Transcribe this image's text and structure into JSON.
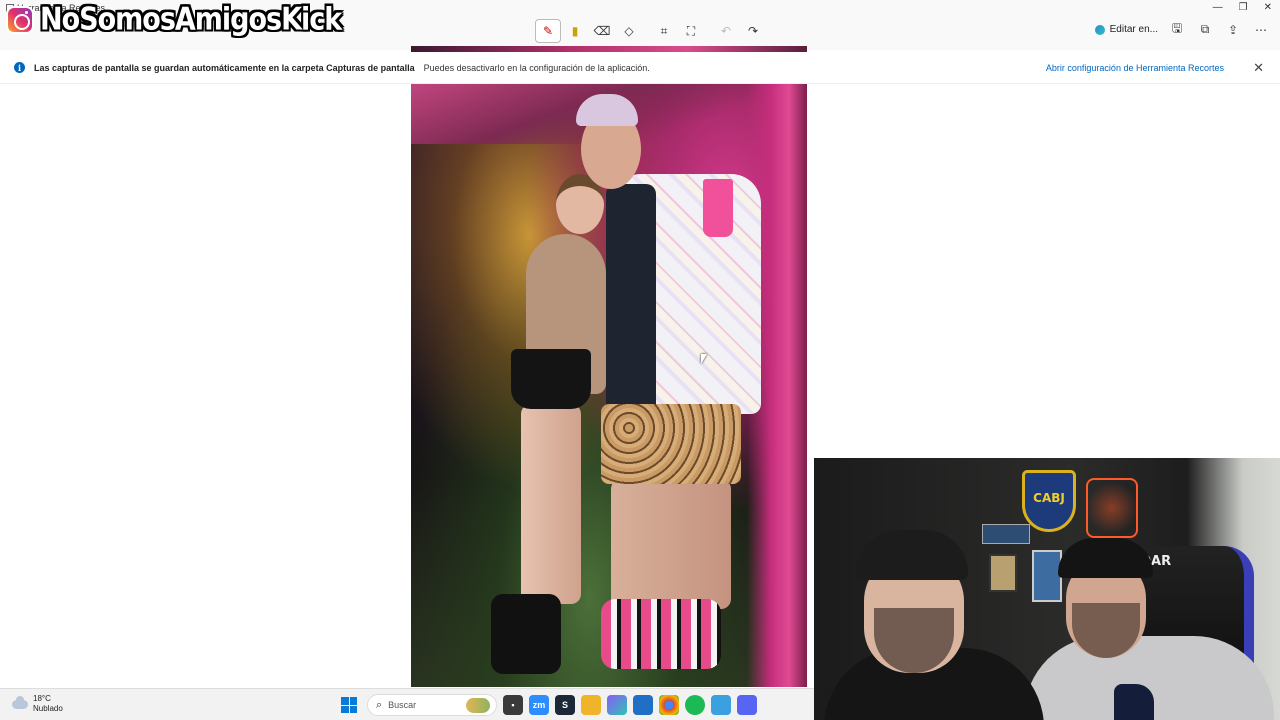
{
  "window": {
    "title": "Herramienta Recortes",
    "new_label": "N"
  },
  "overlay": {
    "channel_name": "NoSomosAmigosKick"
  },
  "toolbar": {
    "tools": [
      {
        "name": "pen-tool",
        "glyph": "✎",
        "active": true
      },
      {
        "name": "highlighter-tool",
        "glyph": "▮",
        "active": false
      },
      {
        "name": "eraser-tool",
        "glyph": "⌫",
        "active": false
      },
      {
        "name": "shapes-tool",
        "glyph": "◇",
        "active": false
      },
      {
        "name": "crop-tool",
        "glyph": "⌗",
        "active": false
      },
      {
        "name": "text-actions-tool",
        "glyph": "⛶",
        "active": false
      },
      {
        "name": "undo-tool",
        "glyph": "↶",
        "active": false,
        "disabled": true
      },
      {
        "name": "redo-tool",
        "glyph": "↷",
        "active": false
      }
    ],
    "edit_in_label": "Editar en...",
    "right_icons": [
      "save-icon",
      "copy-icon",
      "share-icon",
      "more-icon"
    ]
  },
  "infobar": {
    "title": "Las capturas de pantalla se guardan automáticamente en la carpeta Capturas de pantalla",
    "message": "Puedes desactivarlo en la configuración de la aplicación.",
    "link": "Abrir configuración de Herramienta Recortes",
    "close_glyph": "✕"
  },
  "webcam": {
    "crest_text": "CABJ",
    "chair_text": "ESDAR"
  },
  "taskbar": {
    "weather_temp": "18°C",
    "weather_desc": "Nublado",
    "search_placeholder": "Buscar",
    "apps": [
      {
        "name": "file-explorer-icon",
        "color": "#f3c03b",
        "glyph": ""
      },
      {
        "name": "zoom-icon",
        "color": "#2d8cff",
        "glyph": "zm"
      },
      {
        "name": "steam-icon",
        "color": "#1b2838",
        "glyph": "S"
      },
      {
        "name": "folder-icon",
        "color": "#f0b429",
        "glyph": ""
      },
      {
        "name": "copilot-icon",
        "color": "#8a5cf6",
        "glyph": ""
      },
      {
        "name": "store-icon",
        "color": "#1f6fc5",
        "glyph": ""
      },
      {
        "name": "chrome-icon",
        "color": "#db4437",
        "glyph": ""
      },
      {
        "name": "spotify-icon",
        "color": "#1db954",
        "glyph": ""
      },
      {
        "name": "photos-icon",
        "color": "#3aa0e0",
        "glyph": ""
      },
      {
        "name": "discord-icon",
        "color": "#5865f2",
        "glyph": ""
      }
    ]
  }
}
